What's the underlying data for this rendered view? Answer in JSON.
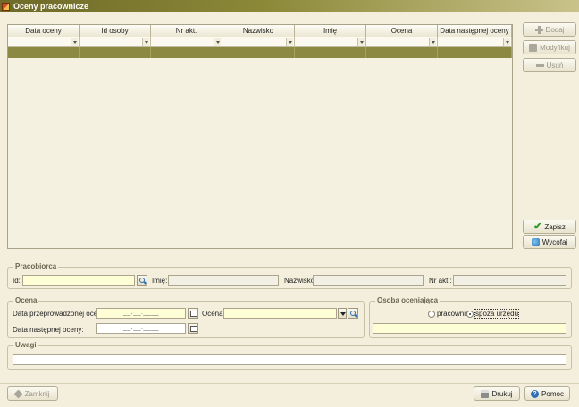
{
  "window": {
    "title": "Oceny pracownicze"
  },
  "grid": {
    "columns": [
      "Data oceny",
      "Id osoby",
      "Nr akt.",
      "Nazwisko",
      "Imię",
      "Ocena",
      "Data następnej oceny"
    ]
  },
  "side_buttons": {
    "add": "Dodaj",
    "edit": "Modyfikuj",
    "delete": "Usuń",
    "save": "Zapisz",
    "revert": "Wycofaj"
  },
  "employer": {
    "legend": "Pracobiorca",
    "id_label": "Id:",
    "first_name_label": "Imię:",
    "last_name_label": "Nazwisko:",
    "file_no_label": "Nr akt.:"
  },
  "rating": {
    "legend": "Ocena",
    "date_done_label": "Data przeprowadzonej oceny:",
    "date_done_value": "__.__.____",
    "rating_label": "Ocena:",
    "next_date_label": "Data następnej oceny:",
    "next_date_value": "__.__.____"
  },
  "rater": {
    "legend": "Osoba oceniająca",
    "opt_employee": "pracownik",
    "opt_external": "spoza urzędu",
    "selected": "spoza urzędu"
  },
  "notes": {
    "legend": "Uwagi"
  },
  "footer": {
    "close": "Zamknij",
    "print": "Drukuj",
    "help": "Pomoc"
  },
  "icons": [
    "plus-icon",
    "edit-icon",
    "minus-icon",
    "check-icon",
    "undo-icon",
    "search-icon",
    "calendar-icon",
    "chevron-down-icon",
    "close-icon",
    "print-icon",
    "help-icon"
  ],
  "colors": {
    "selected_row": "#8c8a42",
    "titlebar": "#6e6a28",
    "field_highlight": "#fdfdd6"
  }
}
